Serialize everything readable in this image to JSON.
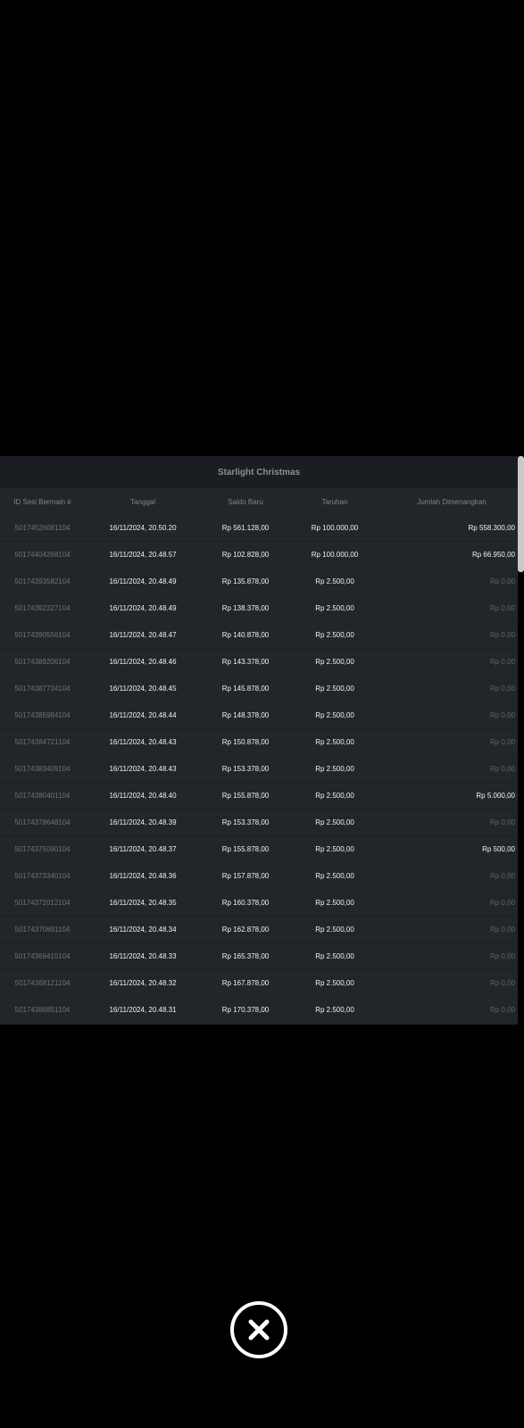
{
  "header": {
    "title": "Starlight Christmas"
  },
  "columns": [
    "ID Sesi Bermain #",
    "Tanggal",
    "Saldo Baru",
    "Taruhan",
    "Jumlah Dimenangkan"
  ],
  "rows": [
    {
      "id": "50174526081104",
      "date": "16/11/2024, 20.50.20",
      "saldo": "Rp 561.128,00",
      "bet": "Rp 100.000,00",
      "win": "Rp 558.300,00",
      "zero": false
    },
    {
      "id": "50174404268104",
      "date": "16/11/2024, 20.48.57",
      "saldo": "Rp 102.828,00",
      "bet": "Rp 100.000,00",
      "win": "Rp 66.950,00",
      "zero": false
    },
    {
      "id": "50174393582104",
      "date": "16/11/2024, 20.48.49",
      "saldo": "Rp 135.878,00",
      "bet": "Rp 2.500,00",
      "win": "Rp 0,00",
      "zero": true
    },
    {
      "id": "50174392327104",
      "date": "16/11/2024, 20.48.49",
      "saldo": "Rp 138.378,00",
      "bet": "Rp 2.500,00",
      "win": "Rp 0,00",
      "zero": true
    },
    {
      "id": "50174390556104",
      "date": "16/11/2024, 20.48.47",
      "saldo": "Rp 140.878,00",
      "bet": "Rp 2.500,00",
      "win": "Rp 0,00",
      "zero": true
    },
    {
      "id": "50174389206104",
      "date": "16/11/2024, 20.48.46",
      "saldo": "Rp 143.378,00",
      "bet": "Rp 2.500,00",
      "win": "Rp 0,00",
      "zero": true
    },
    {
      "id": "50174387734104",
      "date": "16/11/2024, 20.48.45",
      "saldo": "Rp 145.878,00",
      "bet": "Rp 2.500,00",
      "win": "Rp 0,00",
      "zero": true
    },
    {
      "id": "50174385984104",
      "date": "16/11/2024, 20.48.44",
      "saldo": "Rp 148.378,00",
      "bet": "Rp 2.500,00",
      "win": "Rp 0,00",
      "zero": true
    },
    {
      "id": "50174384721104",
      "date": "16/11/2024, 20.48.43",
      "saldo": "Rp 150.878,00",
      "bet": "Rp 2.500,00",
      "win": "Rp 0,00",
      "zero": true
    },
    {
      "id": "50174383409104",
      "date": "16/11/2024, 20.48.43",
      "saldo": "Rp 153.378,00",
      "bet": "Rp 2.500,00",
      "win": "Rp 0,00",
      "zero": true
    },
    {
      "id": "50174380401104",
      "date": "16/11/2024, 20.48.40",
      "saldo": "Rp 155.878,00",
      "bet": "Rp 2.500,00",
      "win": "Rp 5.000,00",
      "zero": false
    },
    {
      "id": "50174378648104",
      "date": "16/11/2024, 20.48.39",
      "saldo": "Rp 153.378,00",
      "bet": "Rp 2.500,00",
      "win": "Rp 0,00",
      "zero": true
    },
    {
      "id": "50174375090104",
      "date": "16/11/2024, 20.48.37",
      "saldo": "Rp 155.878,00",
      "bet": "Rp 2.500,00",
      "win": "Rp 500,00",
      "zero": false
    },
    {
      "id": "50174373340104",
      "date": "16/11/2024, 20.48.36",
      "saldo": "Rp 157.878,00",
      "bet": "Rp 2.500,00",
      "win": "Rp 0,00",
      "zero": true
    },
    {
      "id": "50174372012104",
      "date": "16/11/2024, 20.48.35",
      "saldo": "Rp 160.378,00",
      "bet": "Rp 2.500,00",
      "win": "Rp 0,00",
      "zero": true
    },
    {
      "id": "50174370691104",
      "date": "16/11/2024, 20.48.34",
      "saldo": "Rp 162.878,00",
      "bet": "Rp 2.500,00",
      "win": "Rp 0,00",
      "zero": true
    },
    {
      "id": "50174369415104",
      "date": "16/11/2024, 20.48.33",
      "saldo": "Rp 165.378,00",
      "bet": "Rp 2.500,00",
      "win": "Rp 0,00",
      "zero": true
    },
    {
      "id": "50174368121104",
      "date": "16/11/2024, 20.48.32",
      "saldo": "Rp 167.878,00",
      "bet": "Rp 2.500,00",
      "win": "Rp 0,00",
      "zero": true
    },
    {
      "id": "50174366851104",
      "date": "16/11/2024, 20.48.31",
      "saldo": "Rp 170.378,00",
      "bet": "Rp 2.500,00",
      "win": "Rp 0,00",
      "zero": true
    }
  ],
  "icons": {
    "close": "close-circle-icon"
  },
  "colors": {
    "background": "#000000",
    "panel": "#21262b",
    "title_bar": "#1a1d21",
    "muted": "#5d6369"
  }
}
